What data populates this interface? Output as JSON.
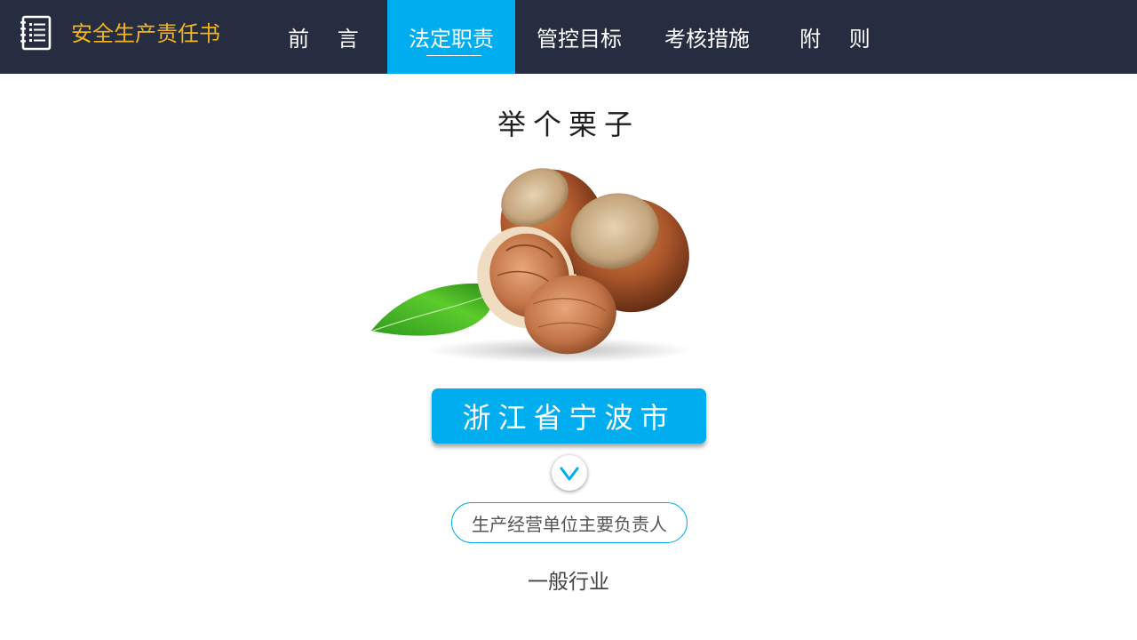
{
  "app": {
    "title": "安全生产责任书",
    "accent_color": "#f2b51c",
    "icon": "notebook-icon"
  },
  "nav": {
    "tabs": [
      {
        "label": "前 言",
        "active": false
      },
      {
        "label": "法定职责",
        "active": true
      },
      {
        "label": "管控目标",
        "active": false
      },
      {
        "label": "考核措施",
        "active": false
      },
      {
        "label": "附 则",
        "active": false
      }
    ],
    "active_color": "#00aeef",
    "bar_color": "#262d40"
  },
  "main": {
    "title": "举个栗子",
    "image": "hazelnuts-image",
    "city_button": "浙江省宁波市",
    "expand_icon": "chevron-down-icon",
    "role": "生产经营单位主要负责人",
    "industry": "一般行业"
  }
}
